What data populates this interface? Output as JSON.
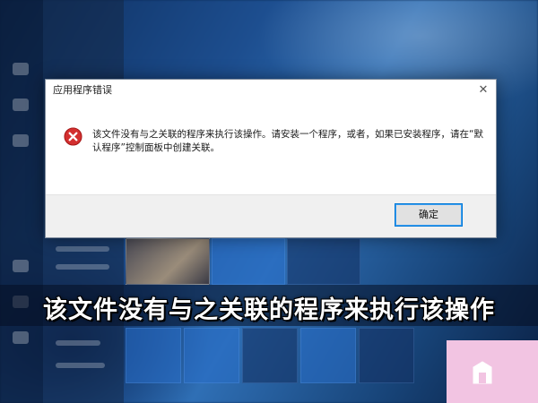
{
  "dialog": {
    "title": "应用程序错误",
    "close_glyph": "✕",
    "message": "该文件没有与之关联的程序来执行该操作。请安装一个程序，或者，如果已安装程序，请在“默认程序”控制面板中创建关联。",
    "ok_label": "确定",
    "icon": "error-icon"
  },
  "banner": {
    "text": "该文件没有与之关联的程序来执行该操作"
  },
  "colors": {
    "error_red": "#d32f2f",
    "button_focus": "#0078d7",
    "watermark": "#f2c4e2"
  }
}
